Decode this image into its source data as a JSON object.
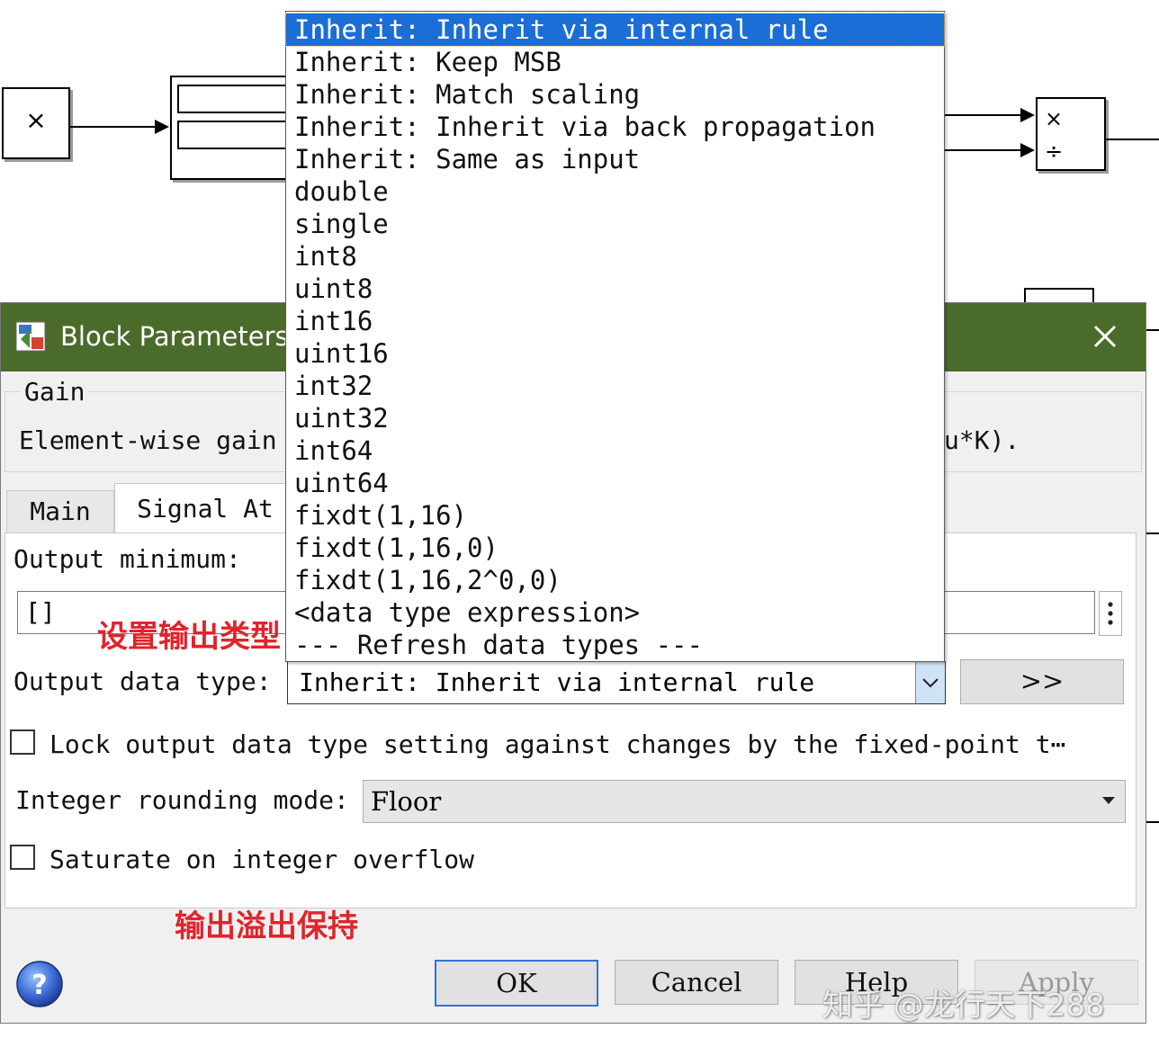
{
  "model": {
    "product_symbol": "×",
    "divide_symbols": [
      "×",
      "÷"
    ]
  },
  "dialog": {
    "title": "Block Parameters",
    "block_name": "Gain",
    "description": "Element-wise gain",
    "description_tail": "u*K).",
    "tabs": [
      {
        "label": "Main"
      },
      {
        "label": "Signal At"
      }
    ],
    "output_minimum_label": "Output minimum:",
    "output_minimum_value": "[]",
    "output_data_type_label": "Output data type:",
    "output_data_type_value": "Inherit: Inherit via internal rule",
    "assistant_button_label": ">>",
    "lock_label": "Lock output data type setting against changes by the fixed-point t⋯",
    "lock_checked": false,
    "rounding_label": "Integer rounding mode:",
    "rounding_value": "Floor",
    "saturate_label": "Saturate on integer overflow",
    "saturate_checked": false,
    "buttons": {
      "ok": "OK",
      "cancel": "Cancel",
      "help": "Help",
      "apply": "Apply"
    }
  },
  "dropdown": {
    "selected_index": 0,
    "options": [
      "Inherit: Inherit via internal rule",
      "Inherit: Keep MSB",
      "Inherit: Match scaling",
      "Inherit: Inherit via back propagation",
      "Inherit: Same as input",
      "double",
      "single",
      "int8",
      "uint8",
      "int16",
      "uint16",
      "int32",
      "uint32",
      "int64",
      "uint64",
      "fixdt(1,16)",
      "fixdt(1,16,0)",
      "fixdt(1,16,2^0,0)",
      "<data type expression>",
      "--- Refresh data types ---"
    ]
  },
  "annotations": {
    "set_output_type": "设置输出类型",
    "saturate_note": "输出溢出保持"
  },
  "watermark": "知乎 @龙行天下288",
  "colors": {
    "titlebar": "#4b6b2a",
    "selection": "#1a6ed6",
    "annotation": "#e0242b"
  }
}
